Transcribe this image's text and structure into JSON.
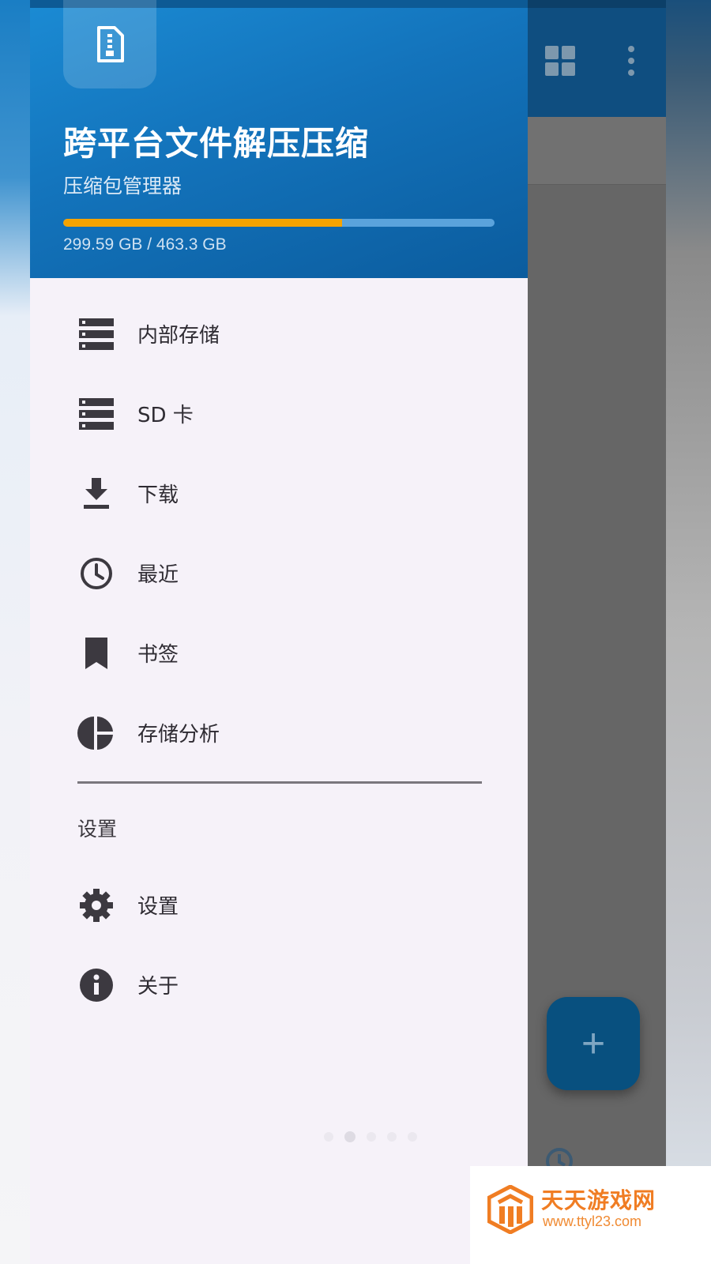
{
  "drawer": {
    "app_title": "跨平台文件解压压缩",
    "app_subtitle": "压缩包管理器",
    "storage": {
      "used_text": "299.59 GB / 463.3 GB",
      "used_fraction": 0.6466
    },
    "items": [
      {
        "label": "内部存储",
        "icon": "storage-icon"
      },
      {
        "label": "SD 卡",
        "icon": "sd-card-icon"
      },
      {
        "label": "下载",
        "icon": "download-icon"
      },
      {
        "label": "最近",
        "icon": "clock-icon"
      },
      {
        "label": "书签",
        "icon": "bookmark-icon"
      },
      {
        "label": "存储分析",
        "icon": "pie-chart-icon"
      }
    ],
    "section_label": "设置",
    "settings_items": [
      {
        "label": "设置",
        "icon": "gear-icon"
      },
      {
        "label": "关于",
        "icon": "info-icon"
      }
    ]
  },
  "watermark": {
    "title": "天天游戏网",
    "url": "www.ttyl23.com"
  },
  "colors": {
    "header_blue": "#1373bb",
    "progress_fill": "#f5a300",
    "icon_dark": "#3c3940",
    "fab_blue": "#08507f"
  }
}
